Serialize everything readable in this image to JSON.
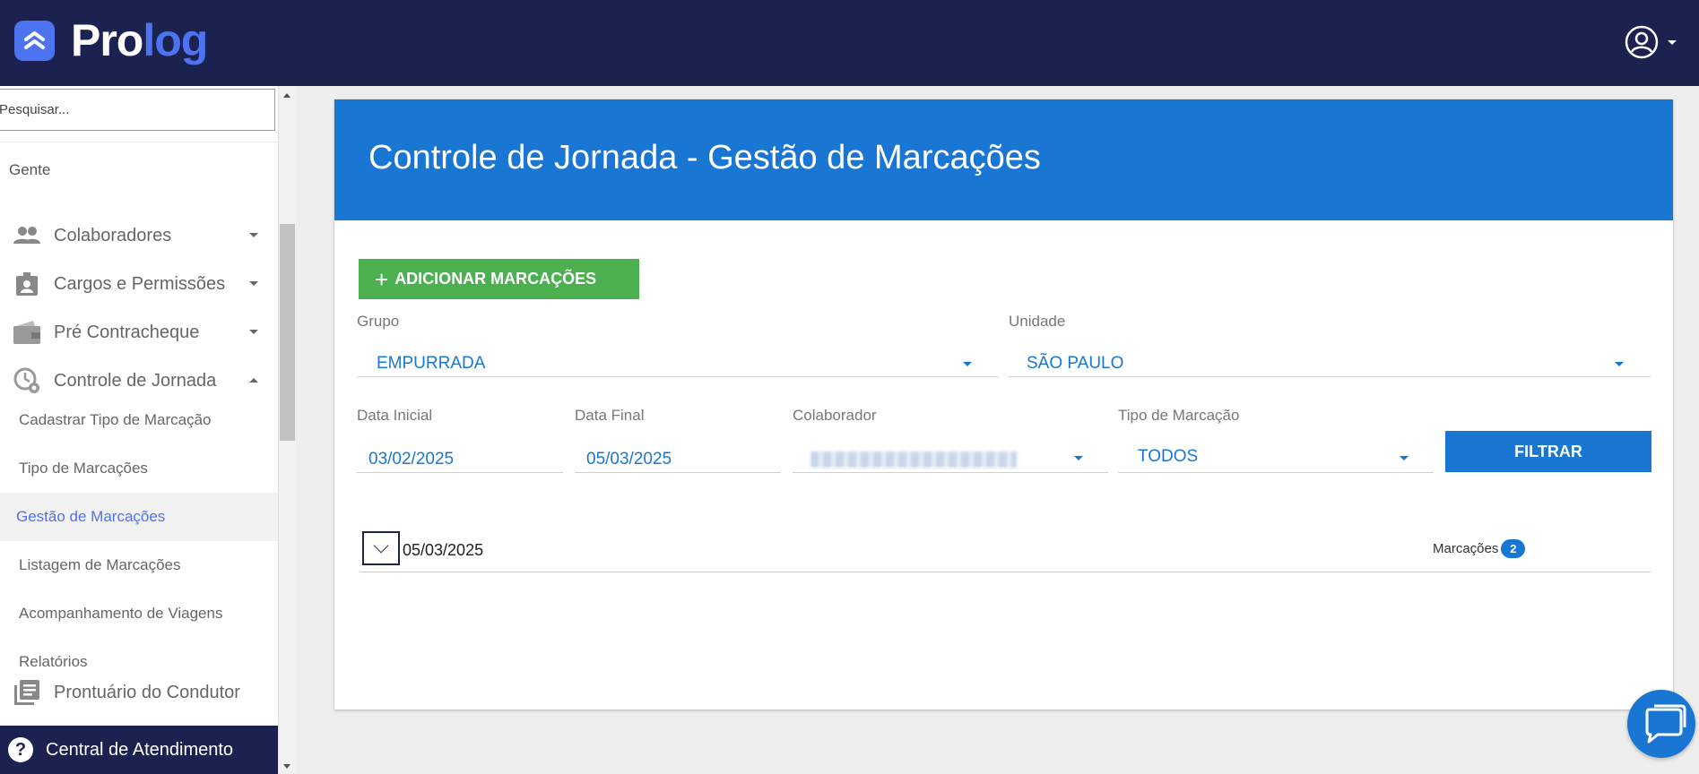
{
  "brand": {
    "logo_pro": "Pro",
    "logo_log": "log",
    "accent": "#4e73f0",
    "topbar_color": "#1b2250"
  },
  "user_menu": {
    "icon": "account-circle-icon"
  },
  "sidebar": {
    "search_placeholder": "Pesquisar...",
    "section": "Gente",
    "items": [
      {
        "label": "Colaboradores",
        "icon": "people-icon"
      },
      {
        "label": "Cargos e Permissões",
        "icon": "badge-icon"
      },
      {
        "label": "Pré Contracheque",
        "icon": "wallet-icon"
      },
      {
        "label": "Controle de Jornada",
        "icon": "clock-gear-icon",
        "expanded": true
      }
    ],
    "subitems": [
      "Cadastrar Tipo de Marcação",
      "Tipo de Marcações",
      "Gestão de Marcações",
      "Listagem de Marcações",
      "Acompanhamento de Viagens",
      "Relatórios"
    ],
    "active_subitem": "Gestão de Marcações",
    "after_items": [
      {
        "label": "Prontuário do Condutor",
        "icon": "document-list-icon"
      }
    ],
    "bottom": {
      "label": "Central de Atendimento",
      "icon": "help-icon"
    }
  },
  "page": {
    "title": "Controle de Jornada - Gestão de Marcações",
    "header_color": "#1976d2",
    "add_button": "ADICIONAR MARCAÇÕES",
    "filters": {
      "grupo": {
        "label": "Grupo",
        "value": "EMPURRADA"
      },
      "unidade": {
        "label": "Unidade",
        "value": "SÃO PAULO"
      },
      "data_inicial": {
        "label": "Data Inicial",
        "value": "03/02/2025"
      },
      "data_final": {
        "label": "Data Final",
        "value": "05/03/2025"
      },
      "colaborador": {
        "label": "Colaborador",
        "value": ""
      },
      "tipo_marcacao": {
        "label": "Tipo de Marcação",
        "value": "TODOS"
      }
    },
    "filter_button": "FILTRAR",
    "results": [
      {
        "date": "05/03/2025",
        "count_label": "Marcações",
        "count": "2"
      }
    ]
  },
  "chat": {
    "icon": "chat-bubble-icon"
  }
}
